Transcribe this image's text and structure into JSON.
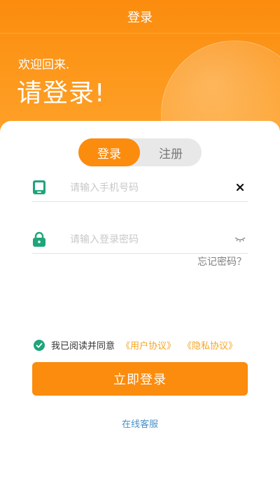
{
  "header": {
    "title": "登录"
  },
  "hero": {
    "welcome": "欢迎回来.",
    "prompt": "请登录!"
  },
  "tabs": [
    {
      "label": "登录",
      "active": true
    },
    {
      "label": "注册",
      "active": false
    }
  ],
  "phone": {
    "placeholder": "请输入手机号码",
    "value": "",
    "icon": "phone-icon",
    "action_icon": "clear-icon"
  },
  "password": {
    "placeholder": "请输入登录密码",
    "value": "",
    "icon": "lock-icon",
    "action_icon": "eye-closed-icon"
  },
  "forgot_label": "忘记密码？",
  "agreement": {
    "checked": true,
    "text": "我已阅读并同意",
    "user_link": "《用户协议》",
    "privacy_link": "《隐私协议》"
  },
  "login_button": "立即登录",
  "service_link": "在线客服",
  "colors": {
    "accent": "#fb8c0e",
    "icon_green": "#1fa57a",
    "link_blue": "#4a90c8",
    "link_orange": "#f5a623"
  }
}
